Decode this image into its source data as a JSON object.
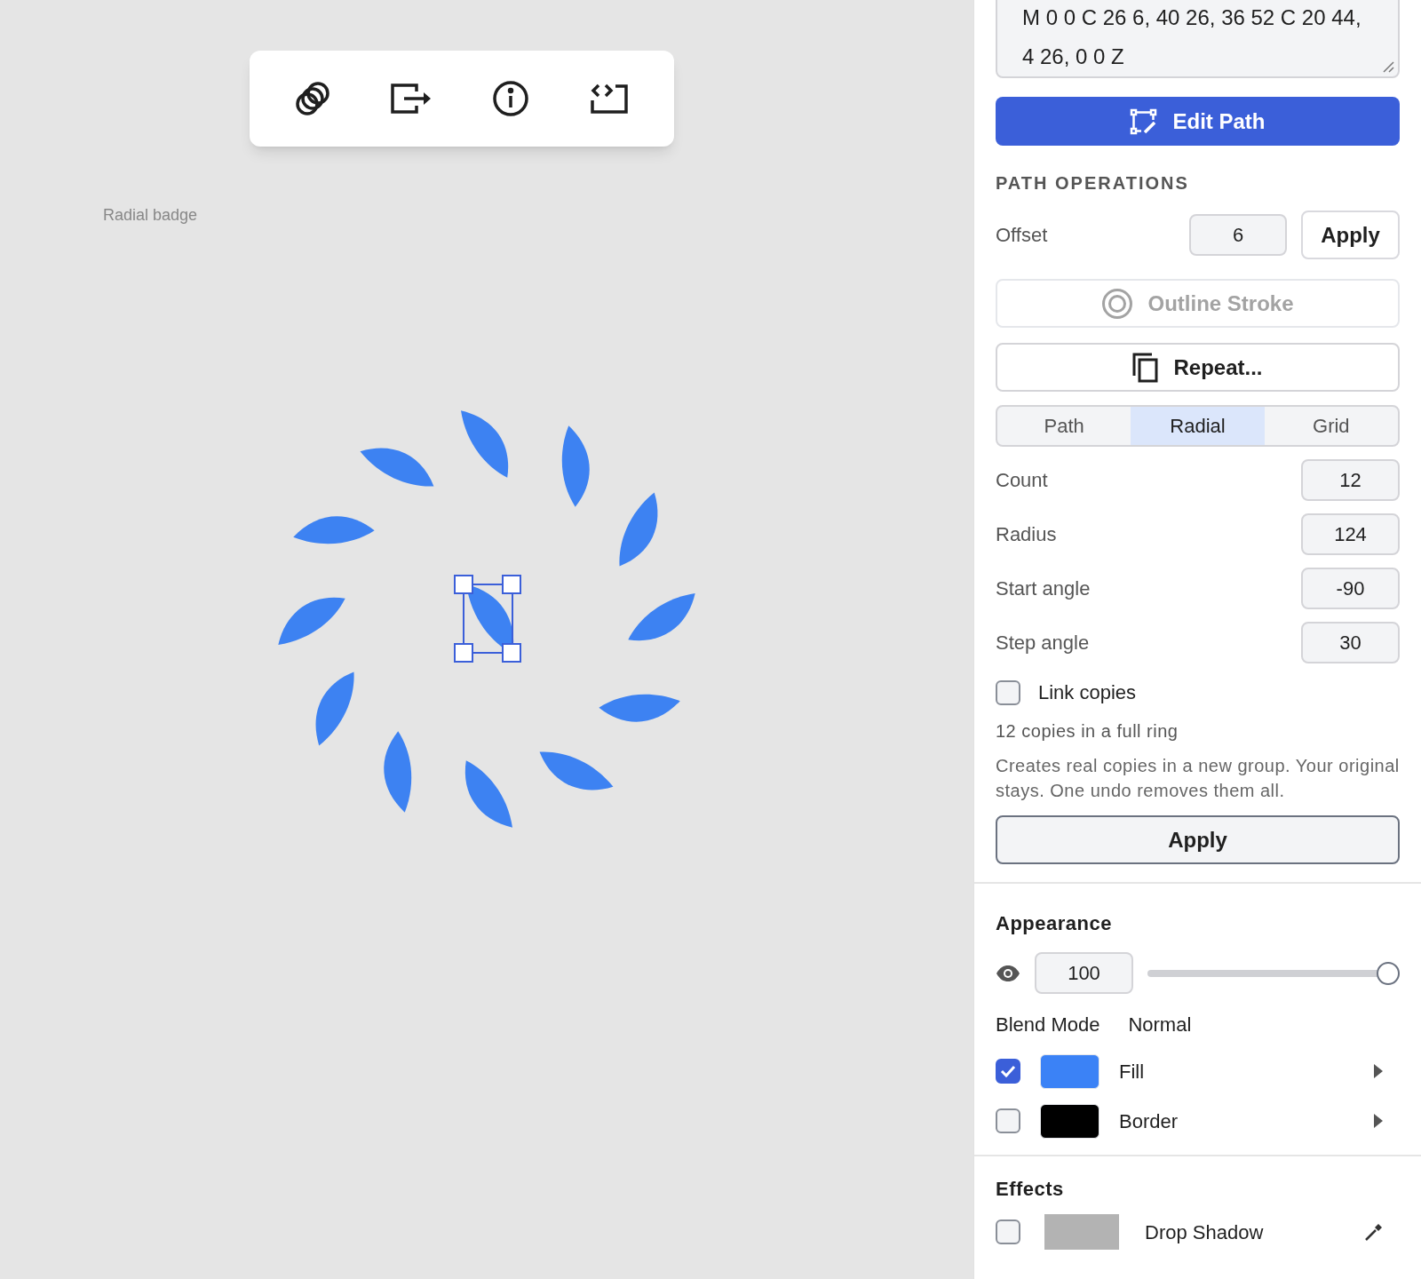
{
  "canvas": {
    "label": "Radial badge"
  },
  "panel": {
    "path_data": "M 0 0 C 26 6, 40 26, 36 52 C 20 44, 4 26, 0 0 Z",
    "edit_button": "Edit Path",
    "path_operations": {
      "heading": "PATH OPERATIONS",
      "offset": {
        "label": "Offset",
        "value": "6",
        "button": "Apply"
      },
      "outline_stroke": {
        "label": "Outline Stroke",
        "disabled": true
      },
      "repeat_button": "Repeat...",
      "tabs": [
        {
          "label": "Path",
          "selected": false
        },
        {
          "label": "Radial",
          "selected": true
        },
        {
          "label": "Grid",
          "selected": false
        }
      ],
      "fields": [
        {
          "label": "Count",
          "value": "12"
        },
        {
          "label": "Radius",
          "value": "124"
        },
        {
          "label": "Start angle",
          "value": "-90"
        },
        {
          "label": "Step angle",
          "value": "30"
        }
      ],
      "link_copies": {
        "label": "Link copies",
        "checked": false
      },
      "summary": "12 copies in a full ring",
      "note": "Creates real copies in a new group. Your original stays. One undo removes them all.",
      "apply_button": "Apply"
    },
    "appearance": {
      "heading": "Appearance",
      "opacity": {
        "value": "100",
        "level": 1
      },
      "blend_mode": {
        "label": "Blend Mode",
        "value": "Normal"
      },
      "layers": [
        {
          "label": "Fill",
          "checked": true,
          "color": "#3b82f6"
        },
        {
          "label": "Border",
          "checked": false,
          "color": "#000000"
        }
      ]
    },
    "effects": {
      "heading": "Effects",
      "items": [
        {
          "label": "Drop Shadow",
          "checked": false,
          "color": "#b3b3b3"
        }
      ]
    }
  }
}
